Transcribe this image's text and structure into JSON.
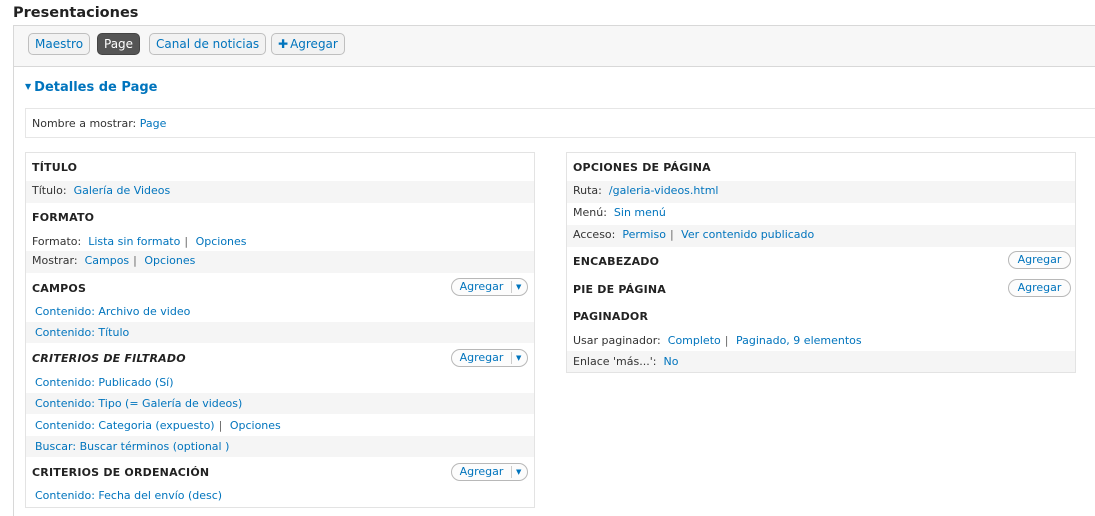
{
  "page_title": "Presentaciones",
  "tabs": {
    "maestro": "Maestro",
    "page": "Page",
    "canal": "Canal de noticias",
    "agregar": "Agregar"
  },
  "details": {
    "heading": "Detalles de Page",
    "name_label": "Nombre a mostrar:",
    "name_value": "Page"
  },
  "left": {
    "titulo": {
      "heading": "TÍTULO",
      "label": "Título:",
      "value": "Galería de Videos"
    },
    "formato": {
      "heading": "FORMATO",
      "formato_label": "Formato:",
      "formato_value": "Lista sin formato",
      "formato_options": "Opciones",
      "mostrar_label": "Mostrar:",
      "mostrar_value": "Campos",
      "mostrar_options": "Opciones"
    },
    "campos": {
      "heading": "CAMPOS",
      "add_label": "Agregar",
      "items": [
        "Contenido: Archivo de video",
        "Contenido: Título"
      ]
    },
    "filtrado": {
      "heading": "CRITERIOS DE FILTRADO",
      "add_label": "Agregar",
      "items": [
        "Contenido: Publicado (Sí)",
        "Contenido: Tipo (= Galería de videos)",
        "Contenido: Categoria (expuesto)",
        "Buscar: Buscar términos (optional )"
      ],
      "categoria_options": "Opciones"
    },
    "ordenacion": {
      "heading": "CRITERIOS DE ORDENACIÓN",
      "add_label": "Agregar",
      "items": [
        "Contenido: Fecha del envío (desc)"
      ]
    }
  },
  "right": {
    "opciones": {
      "heading": "OPCIONES DE PÁGINA",
      "ruta_label": "Ruta:",
      "ruta_value": "/galeria-videos.html",
      "menu_label": "Menú:",
      "menu_value": "Sin menú",
      "acceso_label": "Acceso:",
      "acceso_value": "Permiso",
      "acceso_extra": "Ver contenido publicado"
    },
    "encabezado": {
      "heading": "ENCABEZADO",
      "add_label": "Agregar"
    },
    "pie": {
      "heading": "PIE DE PÁGINA",
      "add_label": "Agregar"
    },
    "paginador": {
      "heading": "PAGINADOR",
      "usar_label": "Usar paginador:",
      "usar_value": "Completo",
      "usar_extra": "Paginado, 9 elementos",
      "enlace_label": "Enlace 'más...':",
      "enlace_value": "No"
    }
  },
  "colors": {
    "link": "#0074bd",
    "active_tab": "#555555"
  }
}
